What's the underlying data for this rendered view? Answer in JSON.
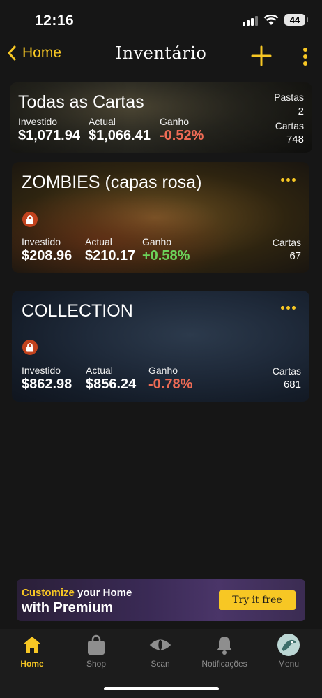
{
  "status": {
    "time": "12:16",
    "battery": "44"
  },
  "nav": {
    "back_label": "Home",
    "title": "Inventário",
    "add_icon": "plus-icon",
    "more_icon": "more-vertical-icon"
  },
  "colors": {
    "accent": "#f7c724",
    "negative": "#ee6b55",
    "positive": "#6cd35a",
    "lock": "#c2431e",
    "background": "#161616"
  },
  "all_cards": {
    "title": "Todas as Cartas",
    "invested_label": "Investido",
    "invested": "$1,071.94",
    "current_label": "Actual",
    "current": "$1,066.41",
    "gain_label": "Ganho",
    "gain": "-0.52%",
    "folders_label": "Pastas",
    "folders": "2",
    "cards_label": "Cartas",
    "cards": "748"
  },
  "binders": [
    {
      "title": "ZOMBIES  (capas rosa)",
      "invested_label": "Investido",
      "invested": "$208.96",
      "current_label": "Actual",
      "current": "$210.17",
      "gain_label": "Ganho",
      "gain": "+0.58%",
      "cards_label": "Cartas",
      "cards": "67"
    },
    {
      "title": "COLLECTION",
      "invested_label": "Investido",
      "invested": "$862.98",
      "current_label": "Actual",
      "current": "$856.24",
      "gain_label": "Ganho",
      "gain": "-0.78%",
      "cards_label": "Cartas",
      "cards": "681"
    }
  ],
  "banner": {
    "highlight": "Customize",
    "line1_rest": " your Home",
    "line2": "with Premium",
    "button": "Try it free"
  },
  "tabs": [
    {
      "label": "Home",
      "icon": "home-icon",
      "active": true
    },
    {
      "label": "Shop",
      "icon": "shopping-bag-icon",
      "active": false
    },
    {
      "label": "Scan",
      "icon": "eye-icon",
      "active": false
    },
    {
      "label": "Notificações",
      "icon": "bell-icon",
      "active": false
    },
    {
      "label": "Menu",
      "icon": "avatar-icon",
      "active": false
    }
  ]
}
